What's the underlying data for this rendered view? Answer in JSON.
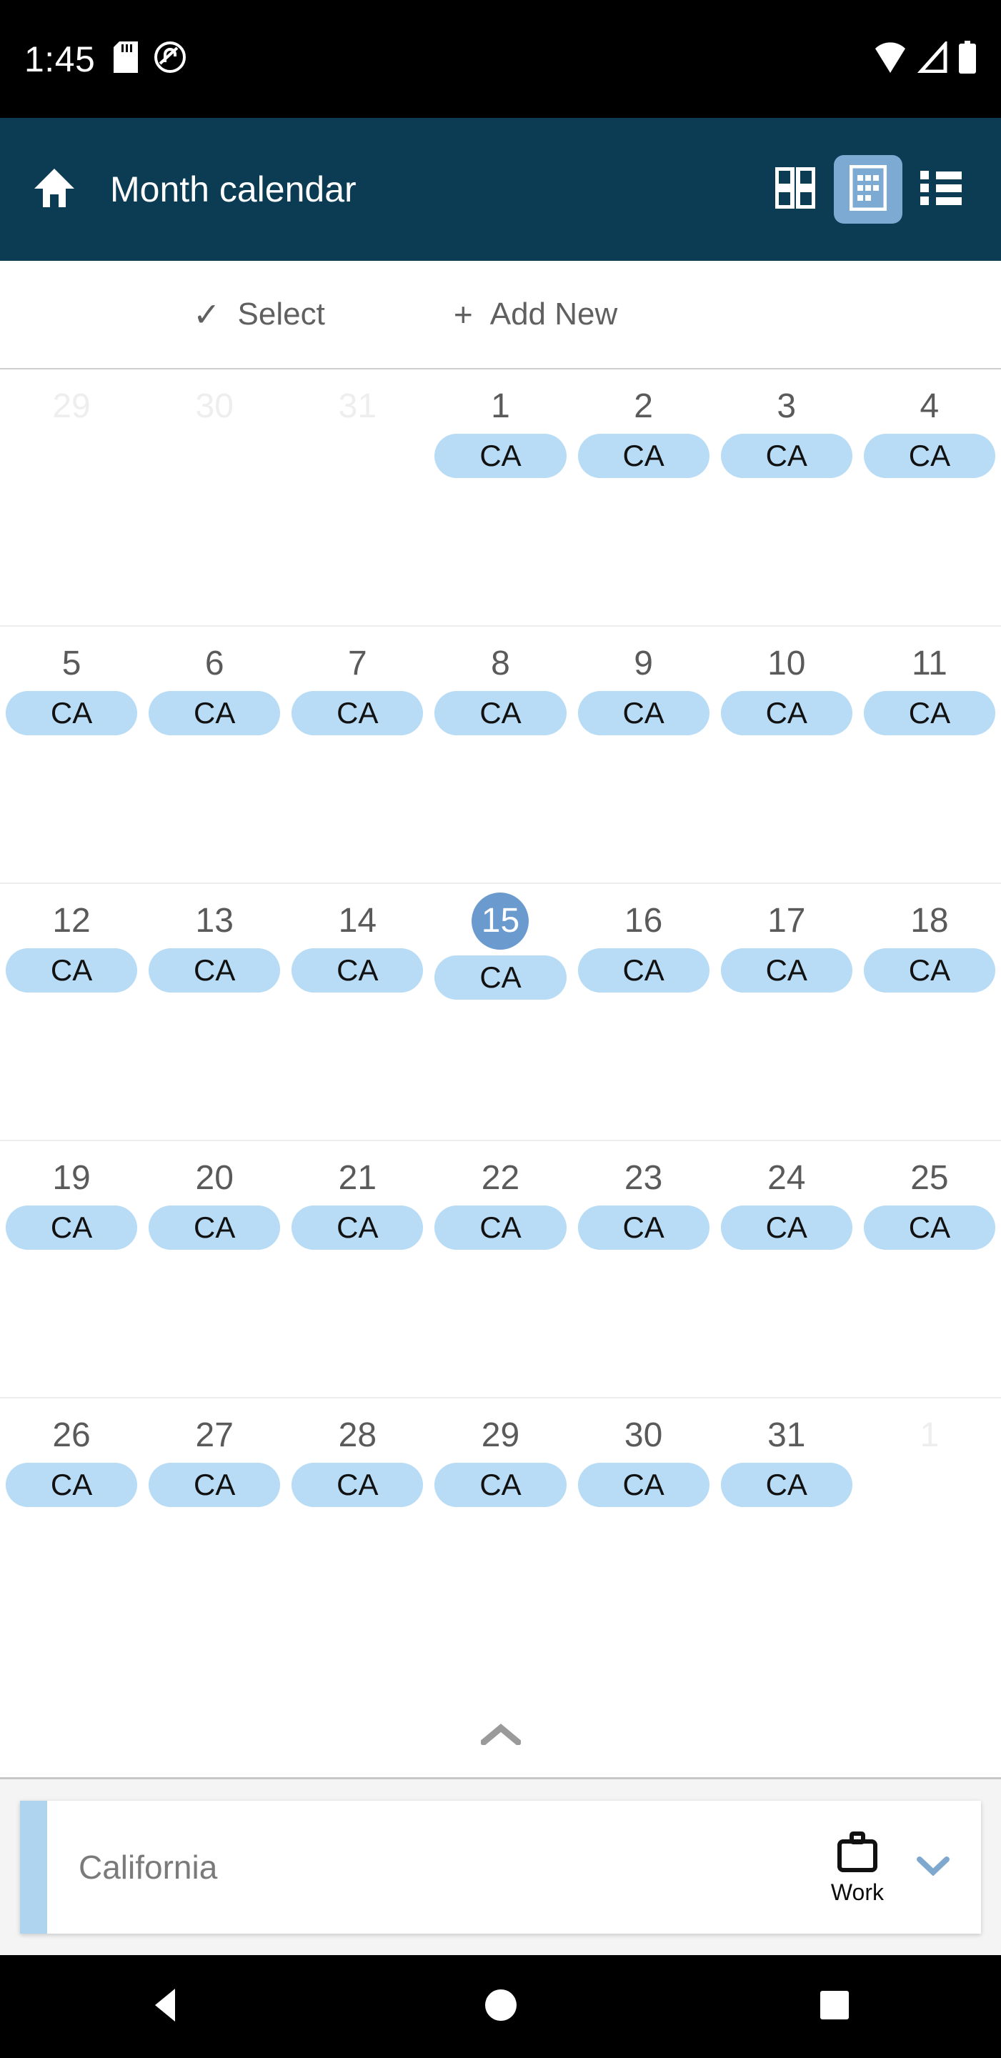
{
  "status_bar": {
    "time": "1:45",
    "icons": [
      "sd-card-icon",
      "do-not-disturb-icon",
      "wifi-icon",
      "cellular-signal-icon",
      "battery-icon"
    ]
  },
  "app_bar": {
    "home_icon": "home-icon",
    "title": "Month calendar",
    "views": [
      {
        "name": "grid-view",
        "icon": "grid-view-icon",
        "active": false
      },
      {
        "name": "month-view",
        "icon": "month-calendar-icon",
        "active": true
      },
      {
        "name": "list-view",
        "icon": "list-view-icon",
        "active": false
      }
    ]
  },
  "actions": {
    "select_glyph": "✓",
    "select_label": "Select",
    "add_glyph": "+",
    "add_label": "Add New"
  },
  "calendar": {
    "selected_day": "15",
    "event_label": "CA",
    "weeks": [
      [
        {
          "day": "29",
          "other": true,
          "event": false
        },
        {
          "day": "30",
          "other": true,
          "event": false
        },
        {
          "day": "31",
          "other": true,
          "event": false
        },
        {
          "day": "1",
          "other": false,
          "event": true
        },
        {
          "day": "2",
          "other": false,
          "event": true
        },
        {
          "day": "3",
          "other": false,
          "event": true
        },
        {
          "day": "4",
          "other": false,
          "event": true
        }
      ],
      [
        {
          "day": "5",
          "other": false,
          "event": true
        },
        {
          "day": "6",
          "other": false,
          "event": true
        },
        {
          "day": "7",
          "other": false,
          "event": true
        },
        {
          "day": "8",
          "other": false,
          "event": true
        },
        {
          "day": "9",
          "other": false,
          "event": true
        },
        {
          "day": "10",
          "other": false,
          "event": true
        },
        {
          "day": "11",
          "other": false,
          "event": true
        }
      ],
      [
        {
          "day": "12",
          "other": false,
          "event": true
        },
        {
          "day": "13",
          "other": false,
          "event": true
        },
        {
          "day": "14",
          "other": false,
          "event": true
        },
        {
          "day": "15",
          "other": false,
          "event": true,
          "selected": true
        },
        {
          "day": "16",
          "other": false,
          "event": true
        },
        {
          "day": "17",
          "other": false,
          "event": true
        },
        {
          "day": "18",
          "other": false,
          "event": true
        }
      ],
      [
        {
          "day": "19",
          "other": false,
          "event": true
        },
        {
          "day": "20",
          "other": false,
          "event": true
        },
        {
          "day": "21",
          "other": false,
          "event": true
        },
        {
          "day": "22",
          "other": false,
          "event": true
        },
        {
          "day": "23",
          "other": false,
          "event": true
        },
        {
          "day": "24",
          "other": false,
          "event": true
        },
        {
          "day": "25",
          "other": false,
          "event": true
        }
      ],
      [
        {
          "day": "26",
          "other": false,
          "event": true
        },
        {
          "day": "27",
          "other": false,
          "event": true
        },
        {
          "day": "28",
          "other": false,
          "event": true
        },
        {
          "day": "29",
          "other": false,
          "event": true
        },
        {
          "day": "30",
          "other": false,
          "event": true
        },
        {
          "day": "31",
          "other": false,
          "event": true
        },
        {
          "day": "1",
          "other": true,
          "event": false
        }
      ]
    ]
  },
  "sheet": {
    "handle_icon": "chevron-up-icon",
    "event": {
      "title": "California",
      "category_icon": "briefcase-icon",
      "category_label": "Work",
      "expand_icon": "chevron-down-icon"
    }
  },
  "nav_bar": {
    "back": "back-triangle-icon",
    "home": "home-circle-icon",
    "recents": "recents-square-icon"
  },
  "colors": {
    "app_bar": "#0b3c54",
    "accent_selected": "#6b9bce",
    "event_chip": "#b8dcf5",
    "card_accent": "#aed4f0",
    "view_active": "#7daad3"
  }
}
